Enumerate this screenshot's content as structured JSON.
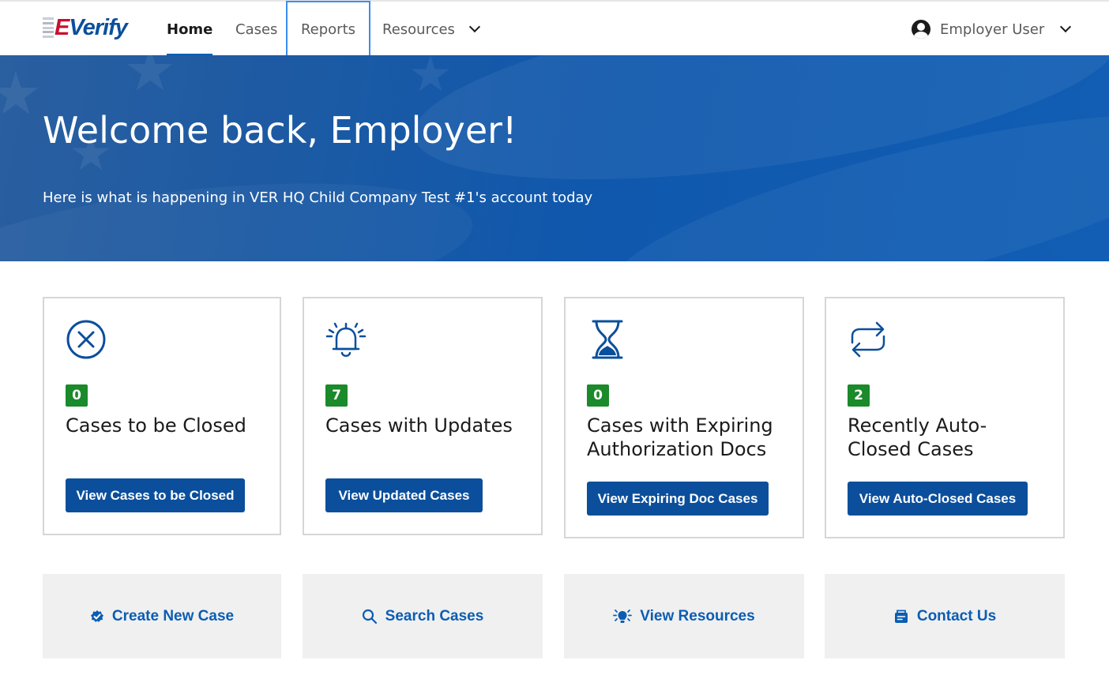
{
  "logo": {
    "first": "E",
    "rest": "Verify"
  },
  "nav": {
    "home": "Home",
    "cases": "Cases",
    "reports": "Reports",
    "resources": "Resources",
    "user": "Employer User"
  },
  "hero": {
    "title": "Welcome back, Employer!",
    "subtitle": "Here is what is happening in VER HQ Child Company Test #1's account today"
  },
  "cards": [
    {
      "count": "0",
      "title": "Cases to be Closed",
      "button": "View Cases to be Closed",
      "icon": "circle-x-icon"
    },
    {
      "count": "7",
      "title": "Cases with Updates",
      "button": "View Updated Cases",
      "icon": "bell-icon"
    },
    {
      "count": "0",
      "title": "Cases with Expiring Authorization Docs",
      "button": "View Expiring Doc Cases",
      "icon": "hourglass-icon"
    },
    {
      "count": "2",
      "title": "Recently Auto-Closed Cases",
      "button": "View Auto-Closed Cases",
      "icon": "repeat-icon"
    }
  ],
  "actions": [
    {
      "label": "Create New Case",
      "icon": "check-badge-icon"
    },
    {
      "label": "Search Cases",
      "icon": "search-icon"
    },
    {
      "label": "View Resources",
      "icon": "lightbulb-icon"
    },
    {
      "label": "Contact Us",
      "icon": "contact-icon"
    }
  ],
  "colors": {
    "primary": "#0b4f9c",
    "link": "#0b5db3",
    "badge": "#1a8a2a",
    "hero": "#115eb4",
    "focus": "#3a8ef0"
  }
}
